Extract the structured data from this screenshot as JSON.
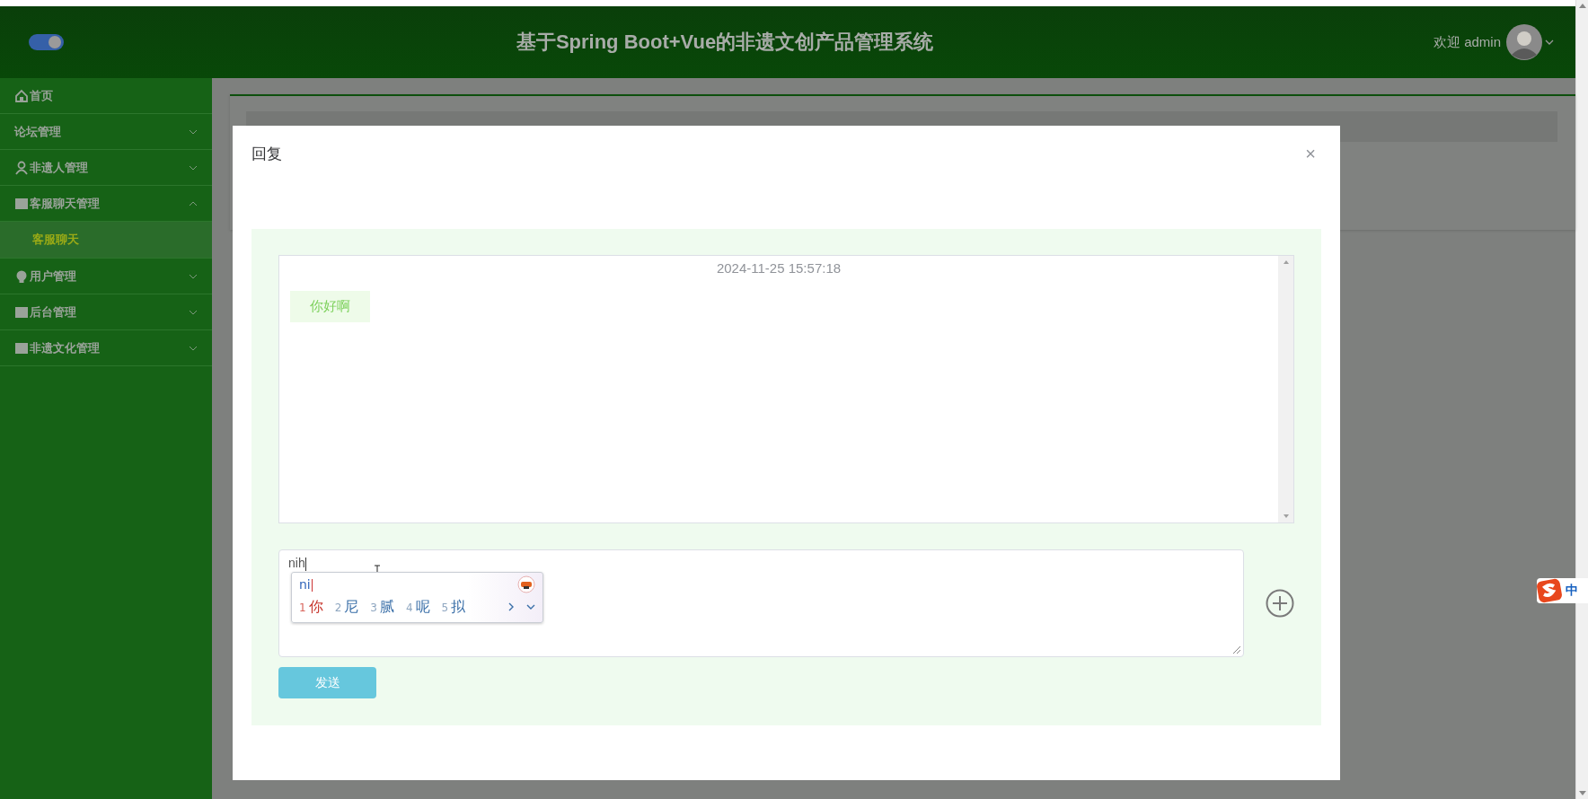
{
  "header": {
    "toggle_on": true,
    "title": "基于Spring Boot+Vue的非遗文创产品管理系统",
    "greeting": "欢迎 admin"
  },
  "sidebar": {
    "items": [
      {
        "label": "首页",
        "kind": "link"
      },
      {
        "label": "论坛管理",
        "kind": "menu",
        "expanded": false
      },
      {
        "label": "非遗人管理",
        "kind": "menu",
        "expanded": false
      },
      {
        "label": "客服聊天管理",
        "kind": "menu",
        "expanded": true,
        "children": [
          {
            "label": "客服聊天",
            "selected": true
          }
        ]
      },
      {
        "label": "用户管理",
        "kind": "menu",
        "expanded": false
      },
      {
        "label": "后台管理",
        "kind": "menu",
        "expanded": false
      },
      {
        "label": "非遗文化管理",
        "kind": "menu",
        "expanded": false
      }
    ]
  },
  "dialog": {
    "title": "回复",
    "close": "×",
    "messages": [
      {
        "time": "2024-11-25 15:57:18",
        "text": "你好啊"
      }
    ],
    "input": {
      "value": "nih"
    },
    "send_button": "发送"
  },
  "ime": {
    "composition": "ni",
    "candidates": [
      {
        "number": "1",
        "text": "你",
        "selected": true
      },
      {
        "number": "2",
        "text": "尼",
        "selected": false
      },
      {
        "number": "3",
        "text": "腻",
        "selected": false
      },
      {
        "number": "4",
        "text": "呢",
        "selected": false
      },
      {
        "number": "5",
        "text": "拟",
        "selected": false
      }
    ]
  },
  "ime_status": {
    "mode": "中"
  }
}
